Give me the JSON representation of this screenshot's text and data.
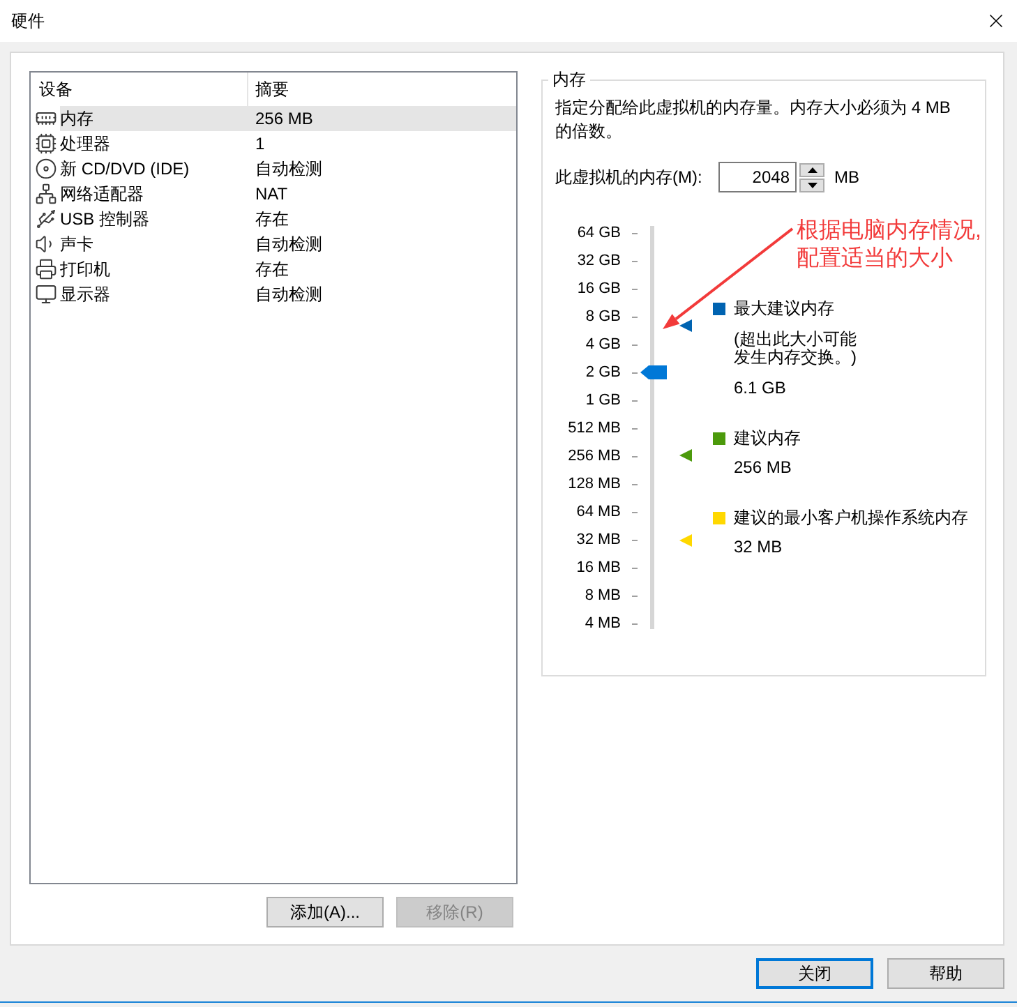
{
  "window": {
    "title": "硬件"
  },
  "device_table": {
    "columns": [
      "设备",
      "摘要"
    ],
    "rows": [
      {
        "kind": "memory",
        "device": "内存",
        "summary": "256 MB",
        "selected": true
      },
      {
        "kind": "processor",
        "device": "处理器",
        "summary": "1",
        "selected": false
      },
      {
        "kind": "cdrom",
        "device": "新 CD/DVD (IDE)",
        "summary": "自动检测",
        "selected": false
      },
      {
        "kind": "network",
        "device": "网络适配器",
        "summary": "NAT",
        "selected": false
      },
      {
        "kind": "usb",
        "device": "USB 控制器",
        "summary": "存在",
        "selected": false
      },
      {
        "kind": "sound",
        "device": "声卡",
        "summary": "自动检测",
        "selected": false
      },
      {
        "kind": "printer",
        "device": "打印机",
        "summary": "存在",
        "selected": false
      },
      {
        "kind": "display",
        "device": "显示器",
        "summary": "自动检测",
        "selected": false
      }
    ]
  },
  "list_buttons": [
    {
      "label": "添加(A)...",
      "disabled": false
    },
    {
      "label": "移除(R)",
      "disabled": true
    }
  ],
  "memory_panel": {
    "title": "内存",
    "description": "指定分配给此虚拟机的内存量。内存大小必须为 4 MB 的倍数。",
    "memory_field": {
      "label": "此虚拟机的内存(M):",
      "value": "2048",
      "unit": "MB"
    },
    "slider": {
      "ticks": [
        "64 GB",
        "32 GB",
        "16 GB",
        "8 GB",
        "4 GB",
        "2 GB",
        "1 GB",
        "512 MB",
        "256 MB",
        "128 MB",
        "64 MB",
        "32 MB",
        "16 MB",
        "8 MB",
        "4 MB"
      ],
      "level": 0.643
    },
    "markers": [
      {
        "label": "最大建议内存",
        "note": "(超出此大小可能发生内存交换。)",
        "value": "6.1 GB",
        "color": "#0063b1",
        "level": 0.764
      },
      {
        "label": "建议内存",
        "value": "256 MB",
        "color": "#4c9a0c",
        "level": 0.432
      },
      {
        "label": "建议的最小客户机操作系统内存",
        "value": "32 MB",
        "color": "#ffd800",
        "level": 0.214
      }
    ]
  },
  "annotation": {
    "text": "根据电脑内存情况,配置适当的大小"
  },
  "dialog_buttons": [
    {
      "label": "关闭",
      "focused": true
    },
    {
      "label": "帮助",
      "focused": false
    }
  ]
}
